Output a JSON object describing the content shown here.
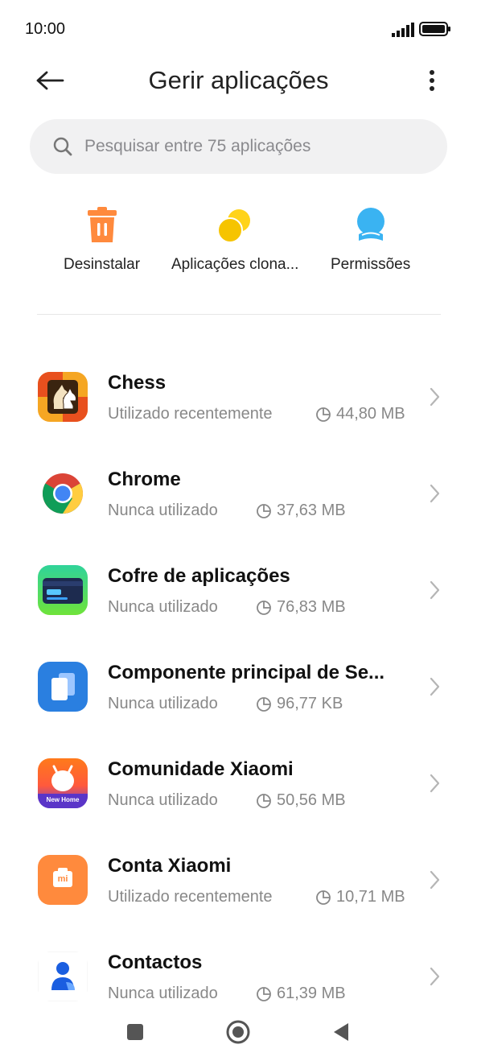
{
  "status": {
    "time": "10:00"
  },
  "header": {
    "title": "Gerir aplicações"
  },
  "search": {
    "placeholder": "Pesquisar entre 75 aplicações"
  },
  "quick_actions": [
    {
      "label": "Desinstalar",
      "icon": "trash-icon",
      "color": "#ff8a3d"
    },
    {
      "label": "Aplicações clona...",
      "icon": "dual-apps-icon",
      "color": "#f6c400"
    },
    {
      "label": "Permissões",
      "icon": "permissions-icon",
      "color": "#3ab3f2"
    }
  ],
  "apps": [
    {
      "name": "Chess",
      "usage": "Utilizado recentemente",
      "size": "44,80 MB",
      "icon": "chess-icon"
    },
    {
      "name": "Chrome",
      "usage": "Nunca utilizado",
      "size": "37,63 MB",
      "icon": "chrome-icon"
    },
    {
      "name": "Cofre de aplicações",
      "usage": "Nunca utilizado",
      "size": "76,83 MB",
      "icon": "app-vault-icon"
    },
    {
      "name": "Componente principal de Se...",
      "usage": "Nunca utilizado",
      "size": "96,77 KB",
      "icon": "component-icon"
    },
    {
      "name": "Comunidade Xiaomi",
      "usage": "Nunca utilizado",
      "size": "50,56 MB",
      "icon": "xiaomi-community-icon",
      "badge": "New Home"
    },
    {
      "name": "Conta Xiaomi",
      "usage": "Utilizado recentemente",
      "size": "10,71 MB",
      "icon": "xiaomi-account-icon",
      "badge": "mi"
    },
    {
      "name": "Contactos",
      "usage": "Nunca utilizado",
      "size": "61,39 MB",
      "icon": "contacts-icon"
    }
  ]
}
